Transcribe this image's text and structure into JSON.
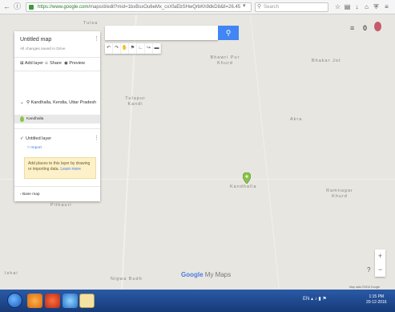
{
  "browser": {
    "url_host": "https://www.google.com",
    "url_rest": "/maps/d/edit?mid=1bxBsxOu6eMx_cxXfaEbSHwQrbKh9dkD8&ll=26.45",
    "search_placeholder": "Search"
  },
  "panel": {
    "title": "Untitled map",
    "saved_status": "All changes saved in Drive",
    "add_layer": "Add layer",
    "share": "Share",
    "preview": "Preview",
    "search_result": "Kandhalla, Kendia, Uttar Pradesh",
    "result_item": "Kandhalla",
    "layer_name": "Untitled layer",
    "import": "Import",
    "info_text": "Add places to this layer by drawing or importing data.",
    "learn_more": "Learn more",
    "base_map": "Base map"
  },
  "map": {
    "places": [
      "Tulsa",
      "Bhawri Pur Khurd",
      "Bhakar Jot",
      "Tulapur Kandi",
      "Akra",
      "Kandhalla",
      "Pithauri",
      "Ramnagar Khurd",
      "Nigwa Budh",
      "Ishai"
    ],
    "logo_google": "Google",
    "logo_suffix": "My Maps",
    "attribution": "Map data ©2016 Google"
  },
  "taskbar": {
    "clock_time": "1:15 PM",
    "clock_date": "20-12-2016"
  }
}
